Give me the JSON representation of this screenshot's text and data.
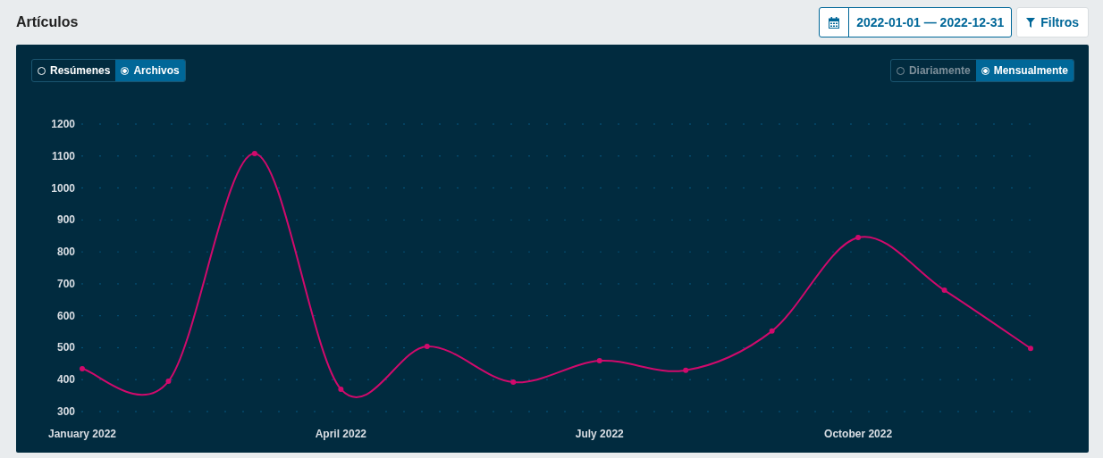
{
  "header": {
    "title": "Artículos",
    "date_range": "2022-01-01 — 2022-12-31",
    "filters_button": "Filtros"
  },
  "chart_panel": {
    "type_toggle": [
      {
        "label": "Resúmenes",
        "selected": false,
        "disabled": false
      },
      {
        "label": "Archivos",
        "selected": true,
        "disabled": false
      }
    ],
    "interval_toggle": [
      {
        "label": "Diariamente",
        "selected": false,
        "disabled": true
      },
      {
        "label": "Mensualmente",
        "selected": true,
        "disabled": false
      }
    ],
    "chart_data": {
      "type": "line",
      "categories": [
        "January 2022",
        null,
        null,
        "April 2022",
        null,
        null,
        "July 2022",
        null,
        null,
        "October 2022",
        null,
        null
      ],
      "series": [
        {
          "color": "#d00a6c",
          "marker": true,
          "values": [
            434,
            395,
            1108,
            370,
            504,
            392,
            459,
            429,
            552,
            845,
            680,
            498
          ]
        }
      ],
      "ylim": [
        300,
        1200
      ],
      "yticks": [
        300,
        400,
        500,
        600,
        700,
        800,
        900,
        1000,
        1100,
        1200
      ]
    }
  }
}
